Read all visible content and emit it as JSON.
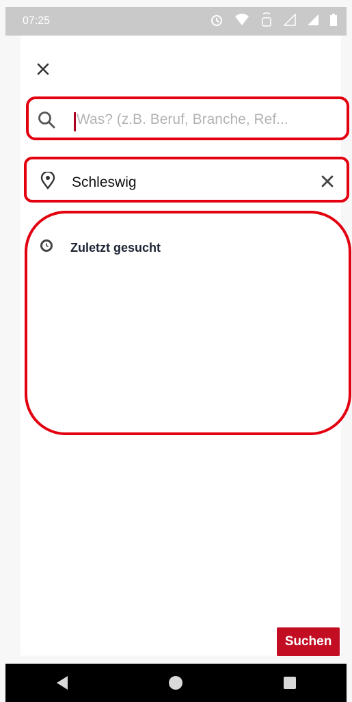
{
  "status_bar": {
    "time": "07:25",
    "icons": [
      "alarm-icon",
      "wifi-icon",
      "volte-icon",
      "signal-empty-icon",
      "signal-icon",
      "battery-icon"
    ]
  },
  "header": {
    "close_icon": "close-icon"
  },
  "search": {
    "placeholder": "Was? (z.B. Beruf, Branche, Ref...",
    "value": "",
    "icon": "search-icon"
  },
  "location": {
    "value": "Schleswig",
    "icon": "location-pin-icon",
    "clear_icon": "clear-icon"
  },
  "recent": {
    "title": "Zuletzt gesucht",
    "icon": "history-icon"
  },
  "actions": {
    "search_label": "Suchen"
  },
  "colors": {
    "accent": "#e3000f",
    "button": "#c30d23",
    "status_bar": "#c9c9c9",
    "nav_bar": "#000000"
  }
}
